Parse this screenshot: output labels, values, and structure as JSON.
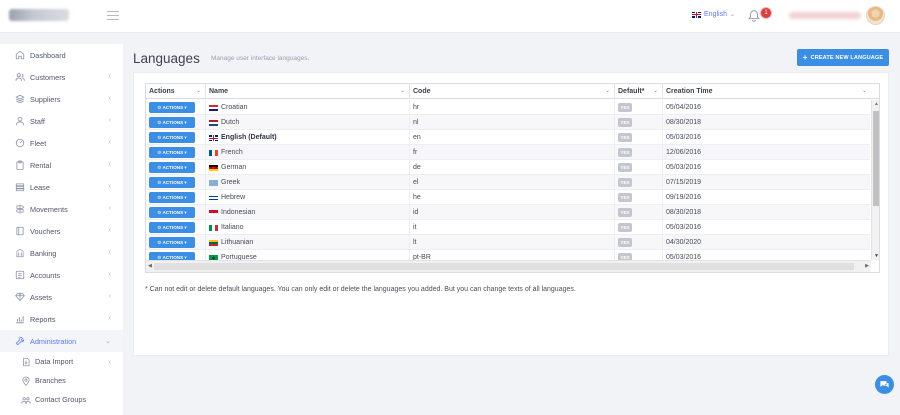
{
  "header": {
    "language": "English",
    "notification_count": "1"
  },
  "sidebar": {
    "items": [
      {
        "label": "Dashboard",
        "icon": "home-icon",
        "chevron": false
      },
      {
        "label": "Customers",
        "icon": "users-icon",
        "chevron": true
      },
      {
        "label": "Suppliers",
        "icon": "layers-icon",
        "chevron": true
      },
      {
        "label": "Staff",
        "icon": "staff-icon",
        "chevron": true
      },
      {
        "label": "Fleet",
        "icon": "gauge-icon",
        "chevron": true
      },
      {
        "label": "Rental",
        "icon": "clipboard-icon",
        "chevron": true
      },
      {
        "label": "Lease",
        "icon": "stack-icon",
        "chevron": true
      },
      {
        "label": "Movements",
        "icon": "signpost-icon",
        "chevron": true
      },
      {
        "label": "Vouchers",
        "icon": "voucher-icon",
        "chevron": true
      },
      {
        "label": "Banking",
        "icon": "bank-icon",
        "chevron": true
      },
      {
        "label": "Accounts",
        "icon": "accounts-icon",
        "chevron": true
      },
      {
        "label": "Assets",
        "icon": "diamond-icon",
        "chevron": true
      },
      {
        "label": "Reports",
        "icon": "chart-icon",
        "chevron": true
      },
      {
        "label": "Administration",
        "icon": "wrench-icon",
        "chevron": true
      }
    ],
    "sub_items": [
      {
        "label": "Data Import",
        "icon": "import-icon",
        "chevron": true
      },
      {
        "label": "Branches",
        "icon": "pin-icon",
        "chevron": false
      },
      {
        "label": "Contact Groups",
        "icon": "group-icon",
        "chevron": false
      }
    ]
  },
  "page": {
    "title": "Languages",
    "subtitle": "Manage user interface languages.",
    "create_button": "CREATE NEW LANGUAGE",
    "note": "* Can not edit or delete default languages. You can only edit or delete the languages you added. But you can change texts of all languages."
  },
  "table": {
    "columns": [
      "Actions",
      "Name",
      "Code",
      "Default*",
      "Creation Time"
    ],
    "actions_label": "ACTIONS",
    "yes_label": "YES",
    "rows": [
      {
        "name": "Croatian",
        "code": "hr",
        "created": "05/04/2016",
        "flag": "croatia",
        "bold": false
      },
      {
        "name": "Dutch",
        "code": "nl",
        "created": "08/30/2018",
        "flag": "netherlands",
        "bold": false
      },
      {
        "name": "English (Default)",
        "code": "en",
        "created": "05/03/2016",
        "flag": "uk",
        "bold": true
      },
      {
        "name": "French",
        "code": "fr",
        "created": "12/06/2016",
        "flag": "france",
        "bold": false
      },
      {
        "name": "German",
        "code": "de",
        "created": "05/03/2016",
        "flag": "germany",
        "bold": false
      },
      {
        "name": "Greek",
        "code": "el",
        "created": "07/15/2019",
        "flag": "greece",
        "bold": false
      },
      {
        "name": "Hebrew",
        "code": "he",
        "created": "09/19/2016",
        "flag": "israel",
        "bold": false
      },
      {
        "name": "Indonesian",
        "code": "id",
        "created": "08/30/2018",
        "flag": "indonesia",
        "bold": false
      },
      {
        "name": "Italiano",
        "code": "it",
        "created": "05/03/2016",
        "flag": "italy",
        "bold": false
      },
      {
        "name": "Lithuanian",
        "code": "lt",
        "created": "04/30/2020",
        "flag": "lithuania",
        "bold": false
      },
      {
        "name": "Portuguese",
        "code": "pt-BR",
        "created": "05/03/2016",
        "flag": "brazil",
        "bold": false
      }
    ]
  },
  "colors": {
    "accent": "#5d78ff",
    "button_blue": "#3a8ee6",
    "badge_red": "#e23b3b"
  }
}
